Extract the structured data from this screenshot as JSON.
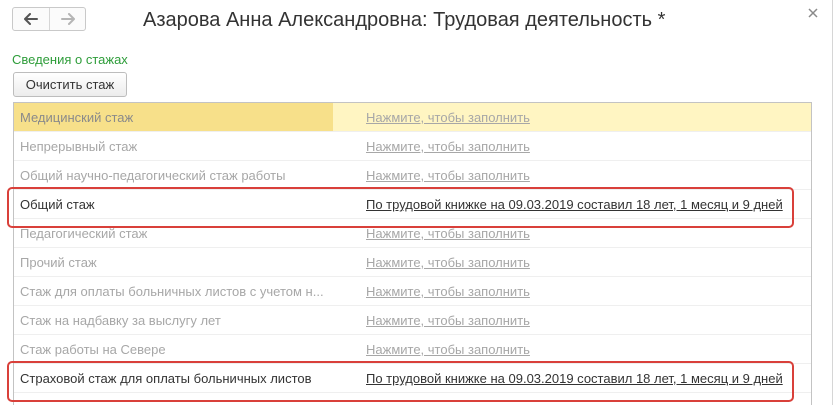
{
  "window": {
    "title": "Азарова Анна Александровна: Трудовая деятельность *"
  },
  "nav": {
    "back_icon": "arrow-left-icon",
    "forward_icon": "arrow-right-icon",
    "close_icon": "close-icon"
  },
  "section": {
    "title": "Сведения о стажах",
    "clear_button": "Очистить стаж"
  },
  "rows": [
    {
      "name": "Медицинский стаж",
      "value": "Нажмите, чтобы заполнить",
      "state": "selected"
    },
    {
      "name": "Непрерывный стаж",
      "value": "Нажмите, чтобы заполнить",
      "state": "empty"
    },
    {
      "name": "Общий научно-педагогический стаж работы",
      "value": "Нажмите, чтобы заполнить",
      "state": "empty"
    },
    {
      "name": "Общий стаж",
      "value": "По трудовой книжке на 09.03.2019 составил 18 лет, 1 месяц и 9 дней",
      "state": "filled",
      "highlighted": true
    },
    {
      "name": "Педагогический стаж",
      "value": "Нажмите, чтобы заполнить",
      "state": "empty"
    },
    {
      "name": "Прочий стаж",
      "value": "Нажмите, чтобы заполнить",
      "state": "empty"
    },
    {
      "name": "Стаж для оплаты больничных листов с учетом н...",
      "value": "Нажмите, чтобы заполнить",
      "state": "empty"
    },
    {
      "name": "Стаж на надбавку за выслугу лет",
      "value": "Нажмите, чтобы заполнить",
      "state": "empty"
    },
    {
      "name": "Стаж работы на Севере",
      "value": "Нажмите, чтобы заполнить",
      "state": "empty"
    },
    {
      "name": "Страховой стаж для оплаты больничных листов",
      "value": "По трудовой книжке на 09.03.2019 составил 18 лет, 1 месяц и 9 дней",
      "state": "filled",
      "highlighted": true
    }
  ],
  "colors": {
    "section_title": "#2e9d3a",
    "selected_row": "#fff5c2",
    "selected_name_cell": "#f7e08a",
    "highlight_border": "#d9403a"
  }
}
